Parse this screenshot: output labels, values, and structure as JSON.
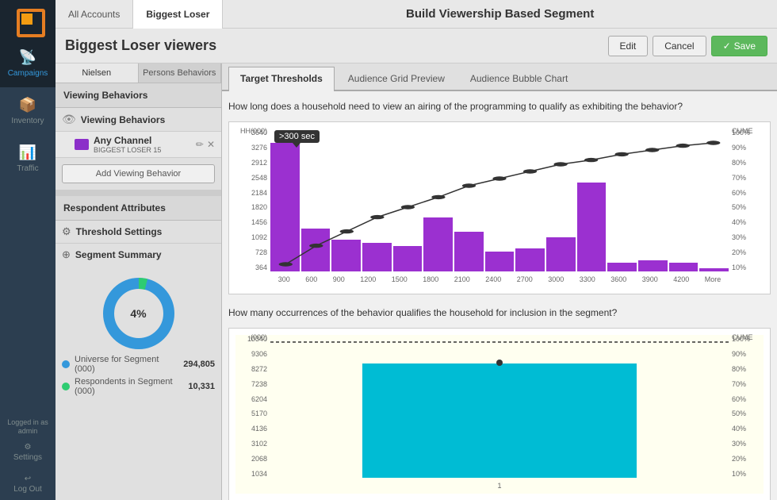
{
  "app": {
    "title": "Build Viewership Based Segment"
  },
  "nav": {
    "tabs": [
      "All Accounts",
      "Biggest Loser"
    ],
    "items": [
      {
        "id": "campaigns",
        "label": "Campaigns",
        "icon": "📡",
        "active": true
      },
      {
        "id": "inventory",
        "label": "Inventory",
        "icon": "📦",
        "active": false
      },
      {
        "id": "traffic",
        "label": "Traffic",
        "icon": "📊",
        "active": false
      }
    ],
    "bottom": [
      {
        "id": "settings",
        "label": "Settings",
        "icon": "⚙"
      },
      {
        "id": "logout",
        "label": "Log Out",
        "icon": "↩"
      }
    ],
    "user": "admin",
    "logged_in_label": "Logged in as"
  },
  "header": {
    "segment_title": "Biggest Loser viewers",
    "edit_label": "Edit",
    "cancel_label": "Cancel",
    "save_label": "Save"
  },
  "left_panel": {
    "tabs": [
      "Nielsen",
      "Persons Behaviors"
    ],
    "viewing_behaviors_title": "Viewing Behaviors",
    "viewing_behaviors_label": "Viewing Behaviors",
    "channel": {
      "name": "Any Channel",
      "sub": "BIGGEST LOSER 15"
    },
    "add_behavior_label": "Add Viewing Behavior",
    "respondent_title": "Respondent Attributes",
    "threshold_settings_label": "Threshold Settings",
    "segment_summary_label": "Segment Summary",
    "donut": {
      "percent": "4%",
      "universe_label": "Universe for Segment (000)",
      "universe_value": "294,805",
      "respondents_label": "Respondents in Segment (000)",
      "respondents_value": "10,331"
    }
  },
  "right_panel": {
    "tabs": [
      "Target Thresholds",
      "Audience Grid Preview",
      "Audience Bubble Chart"
    ],
    "active_tab": 0,
    "chart1": {
      "question": "How long does a household need to view an airing of the programming to qualify as exhibiting the behavior?",
      "tooltip": ">300 sec",
      "y_labels": [
        "3640",
        "3276",
        "2912",
        "2548",
        "2184",
        "1820",
        "1456",
        "1092",
        "728",
        "364"
      ],
      "y_right": [
        "100%",
        "90%",
        "80%",
        "70%",
        "60%",
        "50%",
        "40%",
        "30%",
        "20%",
        "10%"
      ],
      "x_labels": [
        "300",
        "600",
        "900",
        "1200",
        "1500",
        "1800",
        "2100",
        "2400",
        "2700",
        "3000",
        "3300",
        "3600",
        "3900",
        "4200",
        "More"
      ],
      "y_header_left": "HH(000)",
      "y_header_right": "CUME",
      "bars": [
        90,
        30,
        20,
        20,
        18,
        38,
        28,
        14,
        16,
        22,
        62,
        6,
        8,
        6,
        2
      ]
    },
    "chart2": {
      "question": "How many occurrences of the behavior qualifies the household for inclusion in the segment?",
      "y_labels": [
        "10340",
        "9306",
        "8272",
        "7238",
        "6204",
        "5170",
        "4136",
        "3102",
        "2068",
        "1034"
      ],
      "y_right": [
        "100%",
        "90%",
        "80%",
        "70%",
        "60%",
        "50%",
        "40%",
        "30%",
        "20%",
        "10%"
      ],
      "x_labels": [
        "1"
      ],
      "y_header_left": "(000)",
      "y_header_right": "CUME"
    }
  }
}
